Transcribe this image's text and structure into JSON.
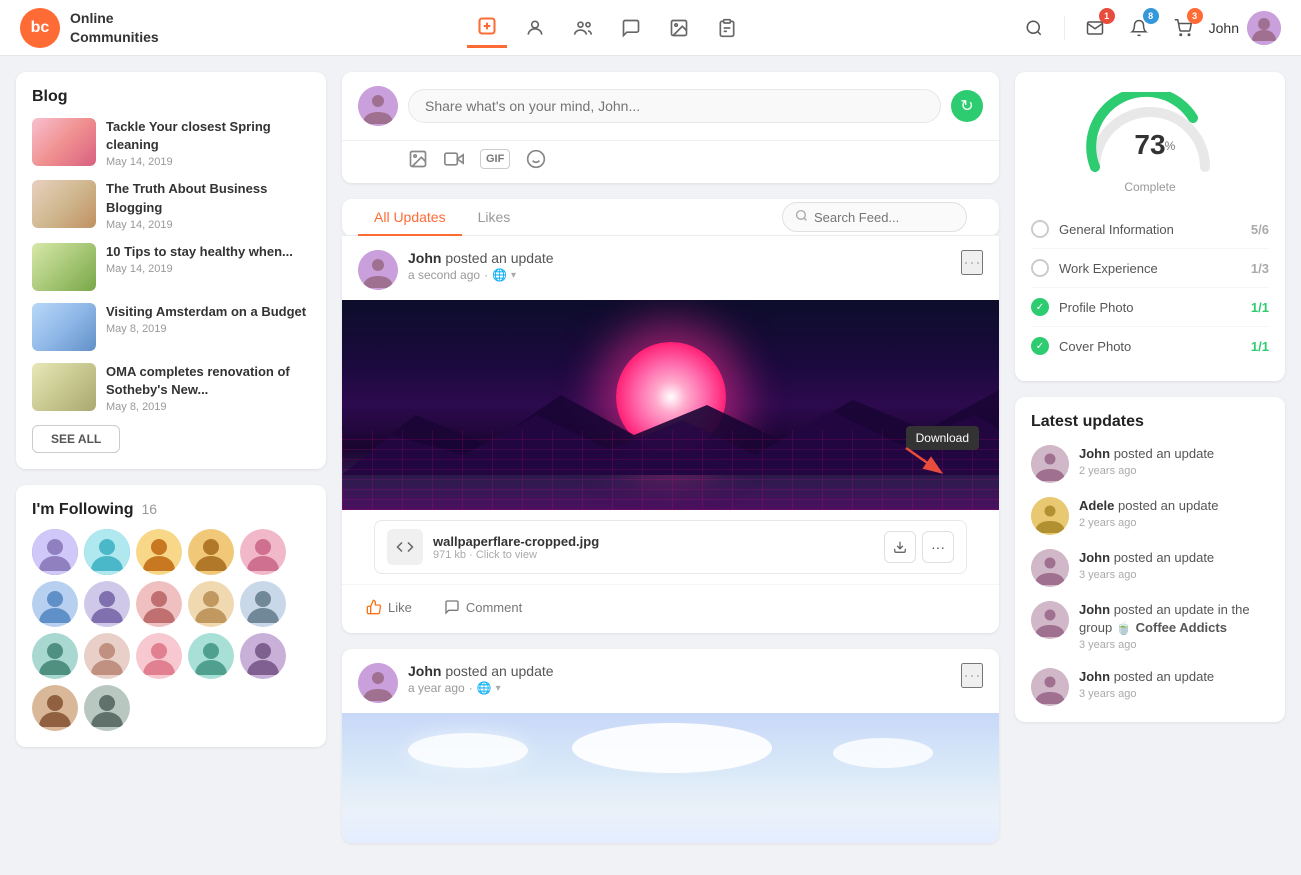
{
  "header": {
    "logo_initials": "bc",
    "logo_text_line1": "Online",
    "logo_text_line2": "Communities",
    "nav_items": [
      {
        "id": "add",
        "icon": "➕",
        "active": true
      },
      {
        "id": "profile",
        "icon": "👤",
        "active": false
      },
      {
        "id": "people",
        "icon": "👥",
        "active": false
      },
      {
        "id": "chat",
        "icon": "💬",
        "active": false
      },
      {
        "id": "gallery",
        "icon": "🖼️",
        "active": false
      },
      {
        "id": "clipboard",
        "icon": "📋",
        "active": false
      }
    ],
    "actions": {
      "search_icon": "🔍",
      "messages_badge": "1",
      "notifications_badge": "8",
      "cart_badge": "3"
    },
    "user_name": "John"
  },
  "blog": {
    "title": "Blog",
    "items": [
      {
        "title": "Tackle Your closest Spring cleaning",
        "date": "May 14, 2019",
        "color": "#f8b8c8"
      },
      {
        "title": "The Truth About Business Blogging",
        "date": "May 14, 2019",
        "color": "#e8d8c8"
      },
      {
        "title": "10 Tips to stay healthy when...",
        "date": "May 14, 2019",
        "color": "#d8e8c8"
      },
      {
        "title": "Visiting Amsterdam on a Budget",
        "date": "May 8, 2019",
        "color": "#c8d8e8"
      },
      {
        "title": "OMA completes renovation of Sotheby's New...",
        "date": "May 8, 2019",
        "color": "#e8e8d8"
      }
    ],
    "see_all_label": "SEE ALL"
  },
  "following": {
    "label": "I'm Following",
    "count": "16",
    "avatars": [
      {
        "color": "#7c6bbf",
        "bg": "#d0c8f8"
      },
      {
        "color": "#4ab8c8",
        "bg": "#b0e8f0"
      },
      {
        "color": "#e8a040",
        "bg": "#f8d888"
      },
      {
        "color": "#e8a040",
        "bg": "#f0c878"
      },
      {
        "color": "#d87090",
        "bg": "#f0b8c8"
      },
      {
        "color": "#6090c8",
        "bg": "#b8d0f0"
      },
      {
        "color": "#9080c0",
        "bg": "#d0c8e8"
      },
      {
        "color": "#c87070",
        "bg": "#f0c0c0"
      },
      {
        "color": "#c8a870",
        "bg": "#f0d8b0"
      },
      {
        "color": "#708898",
        "bg": "#c8d8e8"
      },
      {
        "color": "#509080",
        "bg": "#a8d8d0"
      },
      {
        "color": "#c09080",
        "bg": "#e8d0c8"
      },
      {
        "color": "#e08090",
        "bg": "#f8c8d0"
      },
      {
        "color": "#50a090",
        "bg": "#a8e0d8"
      },
      {
        "color": "#806090",
        "bg": "#c8b0d8"
      },
      {
        "color": "#906040",
        "bg": "#d8b898"
      },
      {
        "color": "#60706a",
        "bg": "#b8c8c0"
      }
    ]
  },
  "composer": {
    "placeholder": "Share what's on your mind, John...",
    "photo_icon": "📷",
    "video_icon": "🎥",
    "gif_icon": "GIF"
  },
  "feed": {
    "tabs": [
      {
        "id": "all-updates",
        "label": "All Updates",
        "active": true
      },
      {
        "id": "likes",
        "label": "Likes",
        "active": false
      }
    ],
    "search_placeholder": "Search Feed...",
    "posts": [
      {
        "id": "post1",
        "author": "John",
        "verb": "posted an update",
        "time": "a second ago",
        "privacy": "🌐",
        "attachment_name": "wallpaperflare-cropped.jpg",
        "attachment_size": "971 kb",
        "attachment_meta": "Click to view",
        "download_tooltip": "Download",
        "like_label": "Like",
        "comment_label": "Comment"
      },
      {
        "id": "post2",
        "author": "John",
        "verb": "posted an update",
        "time": "a year ago",
        "privacy": "🌐"
      }
    ]
  },
  "profile_completion": {
    "percent": "73",
    "label": "Complete",
    "items": [
      {
        "label": "General Information",
        "score": "5/6",
        "complete": false
      },
      {
        "label": "Work Experience",
        "score": "1/3",
        "complete": false
      },
      {
        "label": "Profile Photo",
        "score": "1/1",
        "complete": true
      },
      {
        "label": "Cover Photo",
        "score": "1/1",
        "complete": true
      }
    ]
  },
  "latest_updates": {
    "title": "Latest updates",
    "items": [
      {
        "author": "John",
        "text": "posted an update",
        "time": "2 years ago",
        "avatar_bg": "#d0b8c8"
      },
      {
        "author": "Adele",
        "text": "posted an update",
        "time": "2 years ago",
        "avatar_bg": "#e8c870"
      },
      {
        "author": "John",
        "text": "posted an update",
        "time": "3 years ago",
        "avatar_bg": "#d0b8c8"
      },
      {
        "author": "John",
        "text": "posted an update in the group 🍵 Coffee Addicts",
        "time": "3 years ago",
        "avatar_bg": "#d0b8c8"
      },
      {
        "author": "John",
        "text": "posted an update",
        "time": "3 years ago",
        "avatar_bg": "#d0b8c8"
      }
    ]
  }
}
